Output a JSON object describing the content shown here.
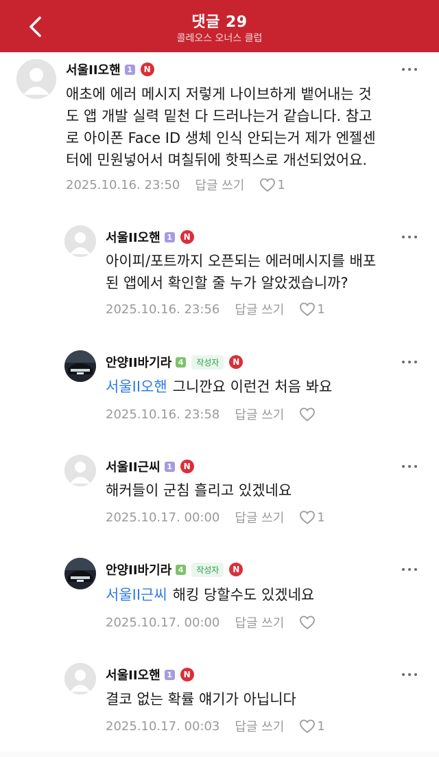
{
  "header": {
    "title": "댓글 29",
    "subtitle": "콜레오스 오너스 클럽"
  },
  "colors": {
    "header_bg": "#c8242f",
    "mention": "#2c7be5",
    "writer_badge_text": "#2e9e4d",
    "level_purple": "#a79ae0",
    "level_green": "#7cc36a",
    "n_badge": "#d92f3a"
  },
  "comments": [
    {
      "author": "서울II오핸",
      "level": "1",
      "writer_badge": "",
      "n_badge": "N",
      "lines": [
        "애초에 에러 메시지 저렇게 나이브하게 뱉어내는 것",
        "도 앱 개발 실력 밑천 다 드러나는거 같습니다. 참고",
        "로 아이폰 Face ID 생체 인식 안되는거 제가 엔젤센",
        "터에 민원넣어서 며칠뒤에 핫픽스로 개선되었어요."
      ],
      "mention": "",
      "date": "2025.10.16. 23:50",
      "reply_label": "답글 쓰기",
      "likes": "1"
    },
    {
      "author": "서울II오핸",
      "level": "1",
      "writer_badge": "",
      "n_badge": "N",
      "lines": [
        "아이피/포트까지 오픈되는 에러메시지를 배포",
        "된 앱에서 확인할 줄 누가 알았겠습니까?"
      ],
      "mention": "",
      "date": "2025.10.16. 23:56",
      "reply_label": "답글 쓰기",
      "likes": "1"
    },
    {
      "author": "안양II바기라",
      "level": "4",
      "writer_badge": "작성자",
      "n_badge": "N",
      "mention": "서울II오핸",
      "lines": [
        "그니깐요 이런건 처음 봐요"
      ],
      "date": "2025.10.16. 23:58",
      "reply_label": "답글 쓰기",
      "likes": ""
    },
    {
      "author": "서울II근씨",
      "level": "1",
      "writer_badge": "",
      "n_badge": "N",
      "mention": "",
      "lines": [
        "해커들이 군침 흘리고 있겠네요"
      ],
      "date": "2025.10.17. 00:00",
      "reply_label": "답글 쓰기",
      "likes": "1"
    },
    {
      "author": "안양II바기라",
      "level": "4",
      "writer_badge": "작성자",
      "n_badge": "N",
      "mention": "서울II근씨",
      "lines": [
        "해킹 당할수도 있겠네요"
      ],
      "date": "2025.10.17. 00:00",
      "reply_label": "답글 쓰기",
      "likes": ""
    },
    {
      "author": "서울II오핸",
      "level": "1",
      "writer_badge": "",
      "n_badge": "N",
      "mention": "",
      "lines": [
        "결코 없는 확률 얘기가 아닙니다"
      ],
      "date": "2025.10.17. 00:03",
      "reply_label": "답글 쓰기",
      "likes": "1"
    }
  ]
}
